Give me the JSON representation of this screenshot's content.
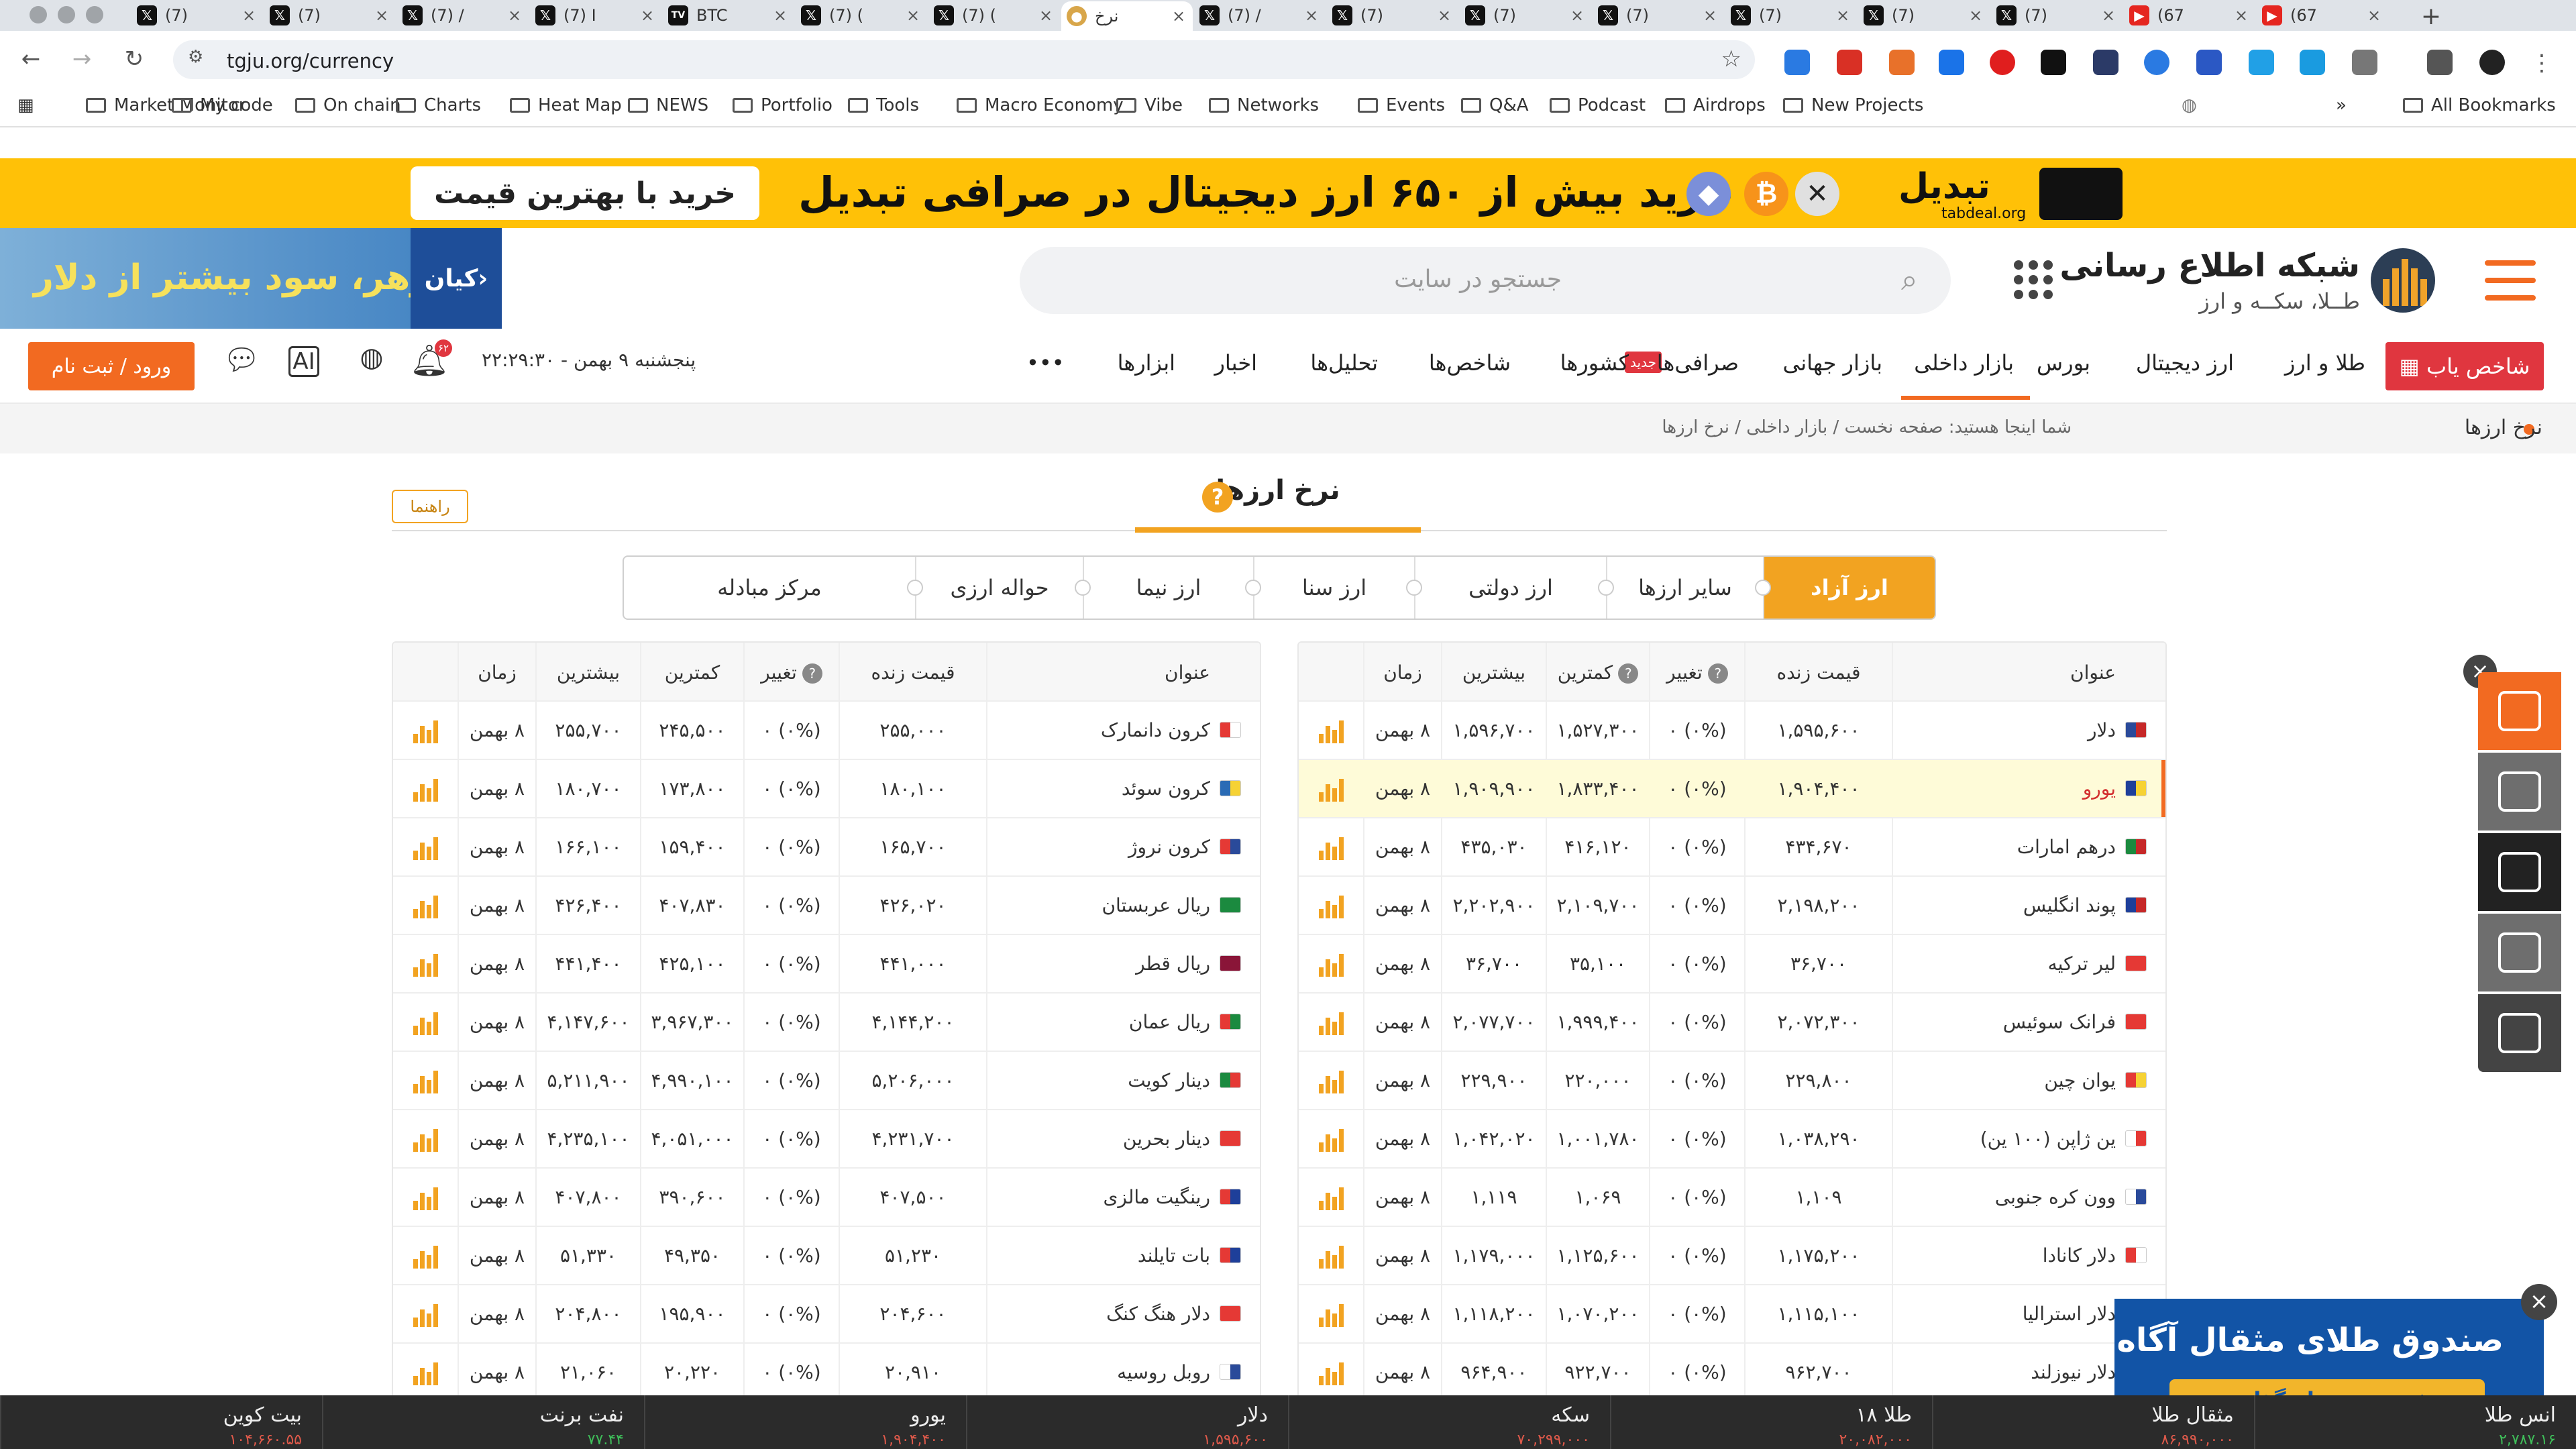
{
  "browser": {
    "tabs": [
      {
        "title": "(7)",
        "icon": "x-logo-icon"
      },
      {
        "title": "(7)",
        "icon": "x-logo-icon"
      },
      {
        "title": "(7) /",
        "icon": "x-logo-icon"
      },
      {
        "title": "(7) I",
        "icon": "x-logo-icon"
      },
      {
        "title": "BTC",
        "icon": "tradingview-icon"
      },
      {
        "title": "(7) (",
        "icon": "x-logo-icon"
      },
      {
        "title": "(7) (",
        "icon": "x-logo-icon"
      },
      {
        "title": "نرخ",
        "icon": "tgju-icon",
        "active": true
      },
      {
        "title": "(7) /",
        "icon": "x-logo-icon"
      },
      {
        "title": "(7)",
        "icon": "x-logo-icon"
      },
      {
        "title": "(7)",
        "icon": "x-logo-icon"
      },
      {
        "title": "(7)",
        "icon": "x-logo-icon"
      },
      {
        "title": "(7)",
        "icon": "x-logo-icon"
      },
      {
        "title": "(7)",
        "icon": "x-logo-icon"
      },
      {
        "title": "(7)",
        "icon": "x-logo-icon"
      },
      {
        "title": "(67",
        "icon": "youtube-icon"
      },
      {
        "title": "(67",
        "icon": "youtube-icon"
      }
    ],
    "url": "tgju.org/currency",
    "bookmarks": [
      "Market Monitor",
      "My code",
      "On chain",
      "Charts",
      "Heat Map",
      "NEWS",
      "Portfolio",
      "Tools",
      "Macro Economy",
      "Vibe",
      "Networks",
      "Events",
      "Q&A",
      "Podcast",
      "Airdrops",
      "New Projects"
    ],
    "more_bookmarks": "»",
    "all_bookmarks": "All Bookmarks"
  },
  "banner": {
    "cta": "خرید با بهترین قیمت",
    "headline": "خرید بیش از ۶۵۰ ارز دیجیتال در صرافی تبدیل",
    "logo": "تبدیل",
    "logo_sub": "tabdeal.org"
  },
  "side_ad": {
    "text": "گوهر، سود بیشتر از دلار",
    "brand": "کیان›"
  },
  "header": {
    "search_placeholder": "جستجو در سایت",
    "brand_name": "شبکه اطلاع رسانی",
    "brand_sub": "طــلا، سکــه و ارز"
  },
  "nav": {
    "index_finder": "شاخص یاب",
    "items": [
      "طلا و ارز",
      "ارز دیجیتال",
      "بورس",
      "بازار داخلی",
      "بازار جهانی",
      "صرافی‌ها",
      "کشورها",
      "شاخص‌ها",
      "تحلیل‌ها",
      "اخبار",
      "ابزارها"
    ],
    "more": "•••",
    "new_badge": "جدید",
    "datetime": "پنجشنبه ۹ بهمن - ۲۲:۲۹:۳۰",
    "notif_count": "۶۲",
    "login": "ورود / ثبت نام"
  },
  "breadcrumb": {
    "title": "نرخ ارزها",
    "trail": "شما اینجا هستید:  صفحه نخست  /  بازار داخلی  /  نرخ ارزها"
  },
  "content": {
    "title": "نرخ ارزها",
    "guide": "راهنما",
    "subtabs": [
      "ارز آزاد",
      "سایر ارزها",
      "ارز دولتی",
      "ارز سنا",
      "ارز نیما",
      "حواله ارزی",
      "مرکز مبادله"
    ]
  },
  "table_headers": {
    "title": "عنوان",
    "live_price": "قیمت زنده",
    "change": "تغییر",
    "low": "کمترین",
    "high": "بیشترین",
    "time": "زمان"
  },
  "table_right": [
    {
      "name": "دلار",
      "price": "۱,۵۹۵,۶۰۰",
      "change": "(۰%) ۰",
      "low": "۱,۵۲۷,۳۰۰",
      "high": "۱,۵۹۶,۷۰۰",
      "time": "۸ بهمن",
      "flag": [
        "#2a4a9a",
        "#c62828"
      ]
    },
    {
      "name": "یورو",
      "price": "۱,۹۰۴,۴۰۰",
      "change": "(۰%) ۰",
      "low": "۱,۸۳۳,۴۰۰",
      "high": "۱,۹۰۹,۹۰۰",
      "time": "۸ بهمن",
      "flag": [
        "#1e3f9a",
        "#f6d234"
      ],
      "highlight": true
    },
    {
      "name": "درهم امارات",
      "price": "۴۳۴,۶۷۰",
      "change": "(۰%) ۰",
      "low": "۴۱۶,۱۲۰",
      "high": "۴۳۵,۰۳۰",
      "time": "۸ بهمن",
      "flag": [
        "#1b8a3f",
        "#c62828"
      ]
    },
    {
      "name": "پوند انگلیس",
      "price": "۲,۱۹۸,۲۰۰",
      "change": "(۰%) ۰",
      "low": "۲,۱۰۹,۷۰۰",
      "high": "۲,۲۰۲,۹۰۰",
      "time": "۸ بهمن",
      "flag": [
        "#1e3f9a",
        "#c62828"
      ]
    },
    {
      "name": "لیر ترکیه",
      "price": "۳۶,۷۰۰",
      "change": "(۰%) ۰",
      "low": "۳۵,۱۰۰",
      "high": "۳۶,۷۰۰",
      "time": "۸ بهمن",
      "flag": [
        "#e53935",
        "#e53935"
      ]
    },
    {
      "name": "فرانک سوئیس",
      "price": "۲,۰۷۲,۳۰۰",
      "change": "(۰%) ۰",
      "low": "۱,۹۹۹,۴۰۰",
      "high": "۲,۰۷۷,۷۰۰",
      "time": "۸ بهمن",
      "flag": [
        "#e53935",
        "#e53935"
      ]
    },
    {
      "name": "یوان چین",
      "price": "۲۲۹,۸۰۰",
      "change": "(۰%) ۰",
      "low": "۲۲۰,۰۰۰",
      "high": "۲۲۹,۹۰۰",
      "time": "۸ بهمن",
      "flag": [
        "#e53935",
        "#f6d234"
      ]
    },
    {
      "name": "ین ژاپن (۱۰۰ ین)",
      "price": "۱,۰۳۸,۲۹۰",
      "change": "(۰%) ۰",
      "low": "۱,۰۰۱,۷۸۰",
      "high": "۱,۰۴۲,۰۲۰",
      "time": "۸ بهمن",
      "flag": [
        "#ffffff",
        "#e53935"
      ]
    },
    {
      "name": "وون کره جنوبی",
      "price": "۱,۱۰۹",
      "change": "(۰%) ۰",
      "low": "۱,۰۶۹",
      "high": "۱,۱۱۹",
      "time": "۸ بهمن",
      "flag": [
        "#ffffff",
        "#2a4a9a"
      ]
    },
    {
      "name": "دلار کانادا",
      "price": "۱,۱۷۵,۲۰۰",
      "change": "(۰%) ۰",
      "low": "۱,۱۲۵,۶۰۰",
      "high": "۱,۱۷۹,۰۰۰",
      "time": "۸ بهمن",
      "flag": [
        "#e53935",
        "#ffffff"
      ]
    },
    {
      "name": "دلار استرالیا",
      "price": "۱,۱۱۵,۱۰۰",
      "change": "(۰%) ۰",
      "low": "۱,۰۷۰,۲۰۰",
      "high": "۱,۱۱۸,۲۰۰",
      "time": "۸ بهمن",
      "flag": [
        "#1e3f9a",
        "#c62828"
      ]
    },
    {
      "name": "دلار نیوزلند",
      "price": "۹۶۲,۷۰۰",
      "change": "(۰%) ۰",
      "low": "۹۲۲,۷۰۰",
      "high": "۹۶۴,۹۰۰",
      "time": "۸ بهمن",
      "flag": [
        "#1e3f9a",
        "#c62828"
      ]
    }
  ],
  "table_left": [
    {
      "name": "کرون دانمارک",
      "price": "۲۵۵,۰۰۰",
      "change": "(۰%) ۰",
      "low": "۲۴۵,۵۰۰",
      "high": "۲۵۵,۷۰۰",
      "time": "۸ بهمن",
      "flag": [
        "#e53935",
        "#ffffff"
      ]
    },
    {
      "name": "کرون سوئد",
      "price": "۱۸۰,۱۰۰",
      "change": "(۰%) ۰",
      "low": "۱۷۳,۸۰۰",
      "high": "۱۸۰,۷۰۰",
      "time": "۸ بهمن",
      "flag": [
        "#2a6bb5",
        "#f6d234"
      ]
    },
    {
      "name": "کرون نروژ",
      "price": "۱۶۵,۷۰۰",
      "change": "(۰%) ۰",
      "low": "۱۵۹,۴۰۰",
      "high": "۱۶۶,۱۰۰",
      "time": "۸ بهمن",
      "flag": [
        "#e53935",
        "#2a4a9a"
      ]
    },
    {
      "name": "ریال عربستان",
      "price": "۴۲۶,۰۲۰",
      "change": "(۰%) ۰",
      "low": "۴۰۷,۸۳۰",
      "high": "۴۲۶,۴۰۰",
      "time": "۸ بهمن",
      "flag": [
        "#1b8a3f",
        "#1b8a3f"
      ]
    },
    {
      "name": "ریال قطر",
      "price": "۴۴۱,۰۰۰",
      "change": "(۰%) ۰",
      "low": "۴۲۵,۱۰۰",
      "high": "۴۴۱,۴۰۰",
      "time": "۸ بهمن",
      "flag": [
        "#8a1538",
        "#8a1538"
      ]
    },
    {
      "name": "ریال عمان",
      "price": "۴,۱۴۴,۲۰۰",
      "change": "(۰%) ۰",
      "low": "۳,۹۶۷,۳۰۰",
      "high": "۴,۱۴۷,۶۰۰",
      "time": "۸ بهمن",
      "flag": [
        "#e53935",
        "#1b8a3f"
      ]
    },
    {
      "name": "دینار کویت",
      "price": "۵,۲۰۶,۰۰۰",
      "change": "(۰%) ۰",
      "low": "۴,۹۹۰,۱۰۰",
      "high": "۵,۲۱۱,۹۰۰",
      "time": "۸ بهمن",
      "flag": [
        "#1b8a3f",
        "#e53935"
      ]
    },
    {
      "name": "دینار بحرین",
      "price": "۴,۲۳۱,۷۰۰",
      "change": "(۰%) ۰",
      "low": "۴,۰۵۱,۰۰۰",
      "high": "۴,۲۳۵,۱۰۰",
      "time": "۸ بهمن",
      "flag": [
        "#e53935",
        "#e53935"
      ]
    },
    {
      "name": "رینگیت مالزی",
      "price": "۴۰۷,۵۰۰",
      "change": "(۰%) ۰",
      "low": "۳۹۰,۶۰۰",
      "high": "۴۰۷,۸۰۰",
      "time": "۸ بهمن",
      "flag": [
        "#e53935",
        "#1e3f9a"
      ]
    },
    {
      "name": "بات تایلند",
      "price": "۵۱,۲۳۰",
      "change": "(۰%) ۰",
      "low": "۴۹,۳۵۰",
      "high": "۵۱,۳۳۰",
      "time": "۸ بهمن",
      "flag": [
        "#e53935",
        "#1e3f9a"
      ]
    },
    {
      "name": "دلار هنگ کنگ",
      "price": "۲۰۴,۶۰۰",
      "change": "(۰%) ۰",
      "low": "۱۹۵,۹۰۰",
      "high": "۲۰۴,۸۰۰",
      "time": "۸ بهمن",
      "flag": [
        "#e53935",
        "#e53935"
      ]
    },
    {
      "name": "روبل روسیه",
      "price": "۲۰,۹۱۰",
      "change": "(۰%) ۰",
      "low": "۲۰,۲۲۰",
      "high": "۲۱,۰۶۰",
      "time": "۸ بهمن",
      "flag": [
        "#ffffff",
        "#2a4a9a"
      ]
    }
  ],
  "gold_ad": {
    "title": "صندوق طلای مثقال آگاه",
    "button": "شروع سرمایه‌گذاری"
  },
  "ticker": [
    {
      "name": "انس طلا",
      "value": "۲,۷۸۷.۱۶",
      "color": "#3fbf5a"
    },
    {
      "name": "مثقال طلا",
      "value": "۸۶,۹۹۰,۰۰۰",
      "color": "#e05a4b"
    },
    {
      "name": "طلا ۱۸",
      "value": "۲۰,۰۸۲,۰۰۰",
      "color": "#e05a4b"
    },
    {
      "name": "سکه",
      "value": "۷۰,۲۹۹,۰۰۰",
      "color": "#e05a4b"
    },
    {
      "name": "دلار",
      "value": "۱,۵۹۵,۶۰۰",
      "color": "#e05a4b"
    },
    {
      "name": "یورو",
      "value": "۱,۹۰۴,۴۰۰",
      "color": "#e05a4b"
    },
    {
      "name": "نفت برنت",
      "value": "۷۷.۴۴",
      "color": "#3fbf5a"
    },
    {
      "name": "بیت کوین",
      "value": "۱۰۴,۶۶۰.۵۵",
      "color": "#e05a4b"
    }
  ],
  "colors": {
    "accent": "#f2a321",
    "brand_orange": "#f26a21",
    "banner_yellow": "#ffc107",
    "danger": "#e0363f"
  }
}
